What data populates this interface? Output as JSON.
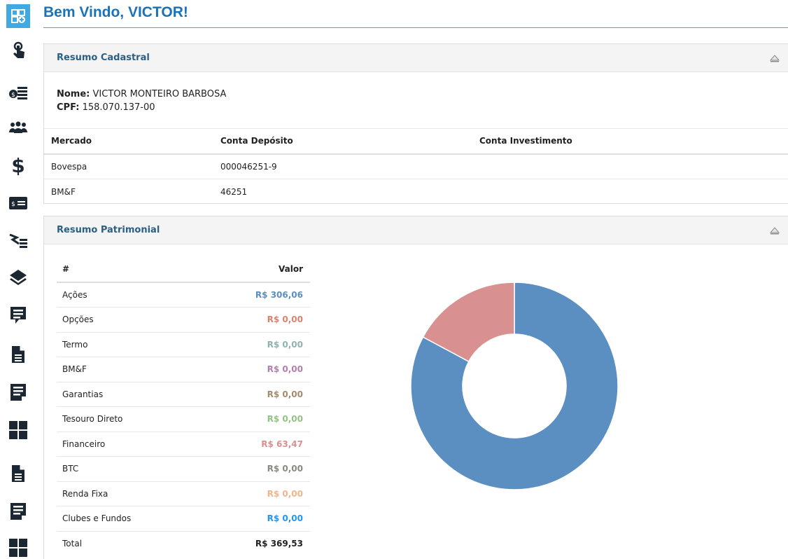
{
  "header": {
    "title": "Bem Vindo, VICTOR!"
  },
  "sidebar": {
    "icons": [
      "dashboard-add-icon",
      "touch-hand-icon",
      "money-list-icon",
      "users-group-icon",
      "dollar-icon",
      "payment-card-icon",
      "transfer-list-icon",
      "layers-icon",
      "message-list-icon",
      "document-icon",
      "form-edit-icon",
      "grid-icon",
      "document-icon",
      "form-edit-icon",
      "grid-icon"
    ]
  },
  "cadastral": {
    "title": "Resumo Cadastral",
    "nome_label": "Nome:",
    "nome_value": "VICTOR MONTEIRO BARBOSA",
    "cpf_label": "CPF:",
    "cpf_value": "158.070.137-00",
    "columns": [
      "Mercado",
      "Conta Depósito",
      "Conta Investimento"
    ],
    "rows": [
      [
        "Bovespa",
        "000046251-9",
        ""
      ],
      [
        "BM&F",
        "46251",
        ""
      ]
    ]
  },
  "patrimonial": {
    "title": "Resumo Patrimonial",
    "columns": [
      "#",
      "Valor"
    ],
    "rows": [
      {
        "label": "Ações",
        "value": "R$ 306,06",
        "color": "#5b8fc2"
      },
      {
        "label": "Opções",
        "value": "R$ 0,00",
        "color": "#d9826f"
      },
      {
        "label": "Termo",
        "value": "R$ 0,00",
        "color": "#8fb3b0"
      },
      {
        "label": "BM&F",
        "value": "R$ 0,00",
        "color": "#b27fb0"
      },
      {
        "label": "Garantias",
        "value": "R$ 0,00",
        "color": "#a8896b"
      },
      {
        "label": "Tesouro Direto",
        "value": "R$ 0,00",
        "color": "#92c285"
      },
      {
        "label": "Financeiro",
        "value": "R$ 63,47",
        "color": "#d99090"
      },
      {
        "label": "BTC",
        "value": "R$ 0,00",
        "color": "#8a8a80"
      },
      {
        "label": "Renda Fixa",
        "value": "R$ 0,00",
        "color": "#f4b48a"
      },
      {
        "label": "Clubes e Fundos",
        "value": "R$ 0,00",
        "color": "#2196f3"
      },
      {
        "label": "Total",
        "value": "R$ 369,53",
        "color": "#222222"
      }
    ]
  },
  "chart_data": {
    "type": "pie",
    "categories": [
      "Ações",
      "Financeiro"
    ],
    "values": [
      306.06,
      63.47
    ],
    "colors": [
      "#5b8fc2",
      "#d99090"
    ]
  },
  "colors": {
    "accent": "#1a73b8",
    "panel_title": "#2a5f86"
  }
}
